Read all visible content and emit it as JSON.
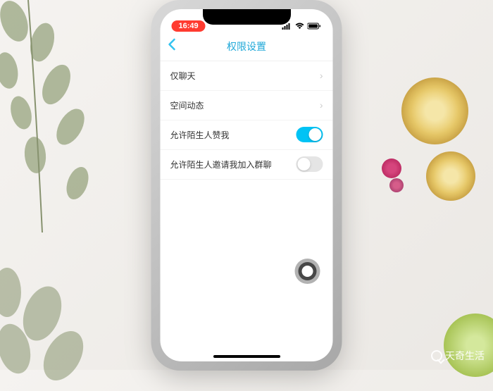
{
  "status_bar": {
    "time": "16:49"
  },
  "nav": {
    "title": "权限设置"
  },
  "settings": {
    "rows": [
      {
        "label": "仅聊天",
        "type": "nav"
      },
      {
        "label": "空间动态",
        "type": "nav"
      },
      {
        "label": "允许陌生人赞我",
        "type": "toggle",
        "on": true
      },
      {
        "label": "允许陌生人邀请我加入群聊",
        "type": "toggle",
        "on": false
      }
    ]
  },
  "watermark": {
    "text": "天奇生活"
  }
}
